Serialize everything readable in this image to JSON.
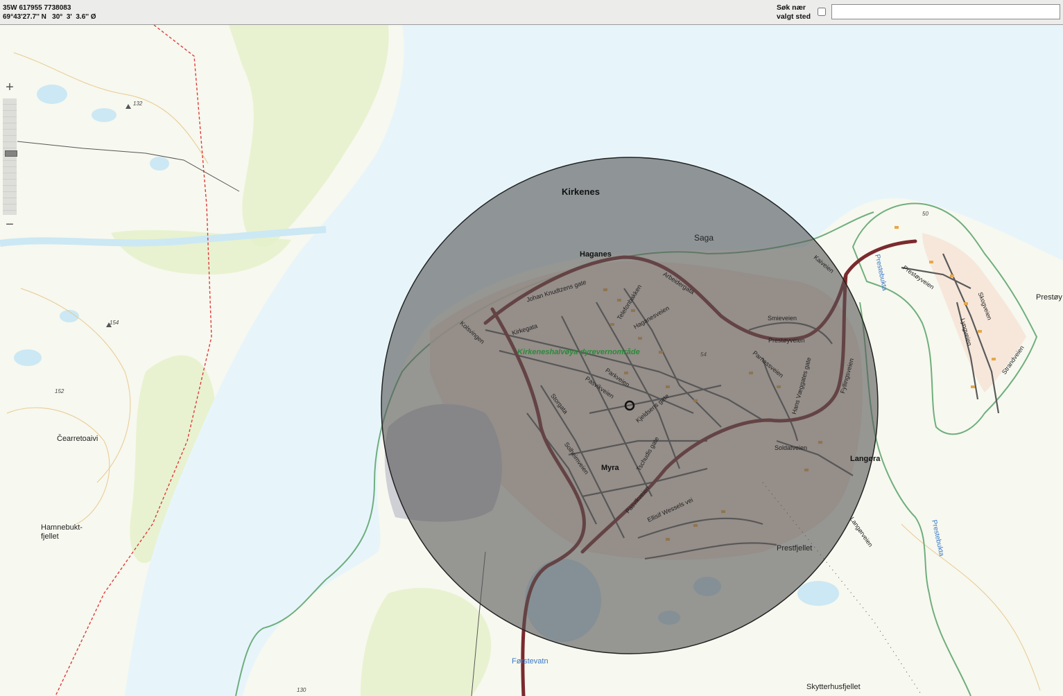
{
  "header": {
    "utm_coordinates": "35W 617955 7738083",
    "geo_coordinates": "69°43'27.7'' N   30°  3'  3.6'' Ø",
    "search_near_label_line1": "Søk nær",
    "search_near_label_line2": "valgt sted",
    "search_near_checked": false,
    "search_value": ""
  },
  "zoom": {
    "in_label": "+",
    "out_label": "−",
    "level_fraction": 0.47
  },
  "colors": {
    "water": "#e7f5fb",
    "land": "#f7f8ef",
    "forest": "#e4f0c8",
    "main_road": "#7a2a2e",
    "overlay": "#555555",
    "protected_area": "#6fae7d"
  },
  "map": {
    "labels": {
      "kirkenes": "Kirkenes",
      "saga": "Saga",
      "haganes": "Haganes",
      "dyrevern": "Kirkeneshalvøya dyrevernområde",
      "myra": "Myra",
      "langora": "Langøra",
      "prestfjellet": "Prestfjellet",
      "forstevatn": "Førstevatn",
      "skytterhusfjellet": "Skytterhusfjellet",
      "cearretoaivi": "Čearretoaivi",
      "hamnebukt1": "Hamnebukt-",
      "hamnebukt2": "fjellet",
      "prestoy": "Prestøy",
      "prestebukta": "Prestebukta",
      "prestebukta2": "Prestebukta",
      "elev132": "132",
      "elev154": "154",
      "elev152": "152",
      "elev130": "130",
      "elev54": "54",
      "elev50": "50"
    },
    "streets": {
      "johan": "Johan Knudtzens gate",
      "kirkegata": "Kirkegata",
      "kolsvingen": "Kolsvingen",
      "teletorvan": "Telefonbakken",
      "haganesveien": "Haganesveien",
      "arbeidergata": "Arbeidergata",
      "smieveien": "Smieveien",
      "prestoyveien": "Prestøyveien",
      "prestoyveien2": "Prestøyveien",
      "parkveien": "Parkveien",
      "pasvikveien": "Pasvikveien",
      "storgata": "Storgata",
      "kjeldsgate": "Kjeldsens gate",
      "solheimveien": "Solheimveien",
      "tschudigate": "Tschudis gate",
      "pasvikveien2": "Pasvikveien",
      "ellisifveien": "Ellisif Wessels vei",
      "soldatveien": "Soldatveien",
      "hasselveien": "Parnassveien",
      "hansvaggata": "Hans Væggates gate",
      "fyllingsveien": "Fyllingsveien",
      "kaiveien": "Kaiveien",
      "skogveien": "Skogveien",
      "lyngveien": "Lyngveien",
      "strandveien": "Strandveien",
      "langorveien": "Langørveien"
    }
  }
}
